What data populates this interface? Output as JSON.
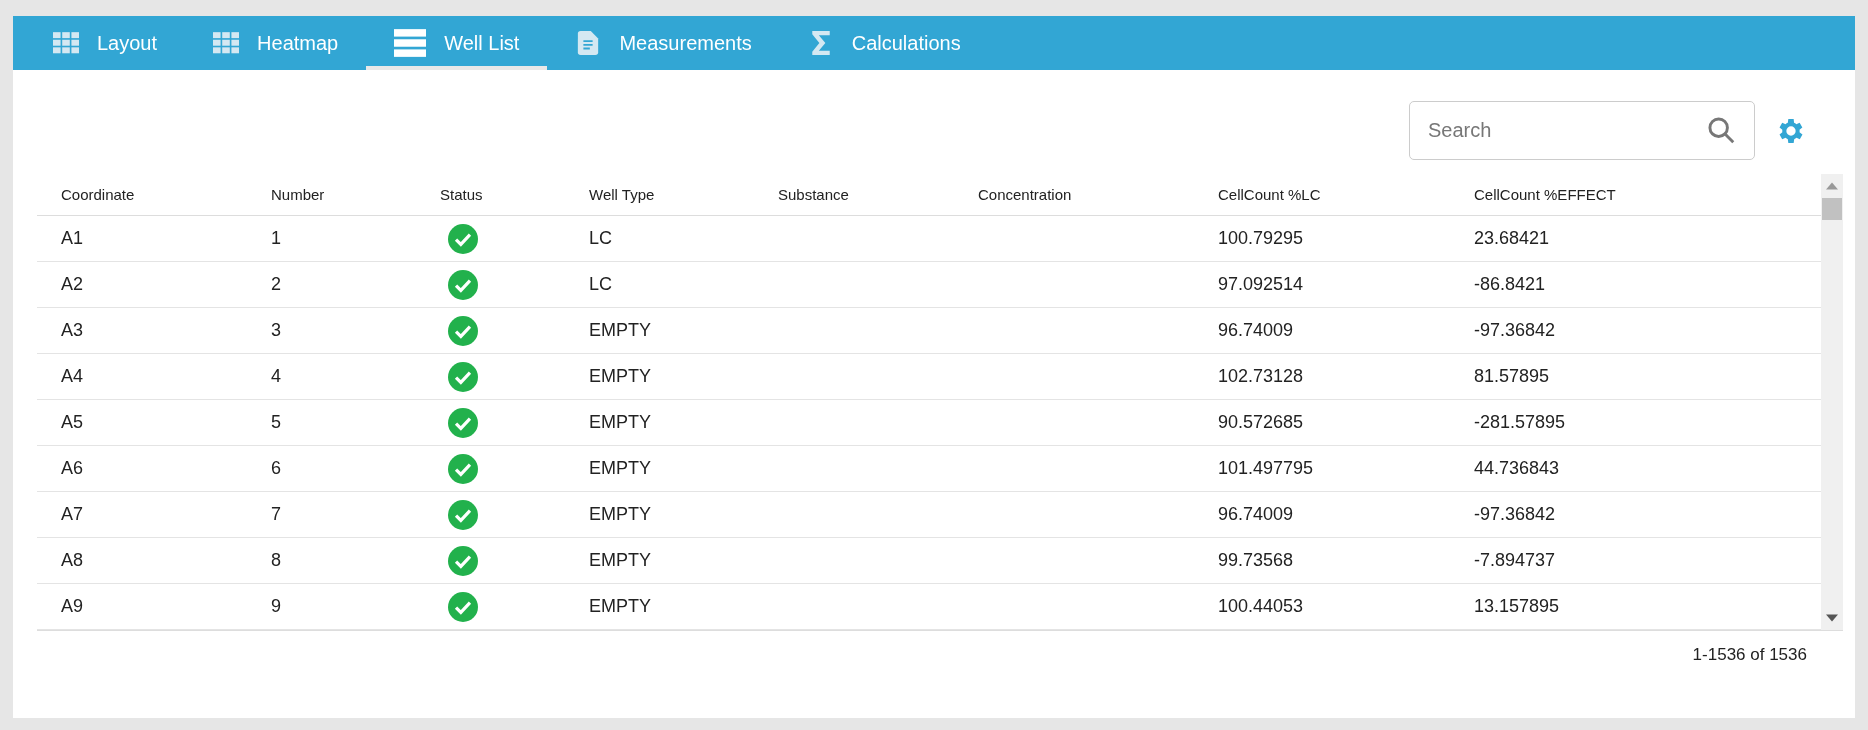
{
  "tabs": [
    {
      "label": "Layout",
      "selected": false
    },
    {
      "label": "Heatmap",
      "selected": false
    },
    {
      "label": "Well List",
      "selected": true
    },
    {
      "label": "Measurements",
      "selected": false
    },
    {
      "label": "Calculations",
      "selected": false
    }
  ],
  "search": {
    "placeholder": "Search"
  },
  "table": {
    "columns": [
      "Coordinate",
      "Number",
      "Status",
      "Well Type",
      "Substance",
      "Concentration",
      "CellCount %LC",
      "CellCount %EFFECT"
    ],
    "rows": [
      {
        "coordinate": "A1",
        "number": "1",
        "ok": true,
        "well_type": "LC",
        "cellcount_lc": "100.79295",
        "cellcount_effect": "23.68421"
      },
      {
        "coordinate": "A2",
        "number": "2",
        "ok": true,
        "well_type": "LC",
        "cellcount_lc": "97.092514",
        "cellcount_effect": "-86.8421"
      },
      {
        "coordinate": "A3",
        "number": "3",
        "ok": true,
        "well_type": "EMPTY",
        "cellcount_lc": "96.74009",
        "cellcount_effect": "-97.36842"
      },
      {
        "coordinate": "A4",
        "number": "4",
        "ok": true,
        "well_type": "EMPTY",
        "cellcount_lc": "102.73128",
        "cellcount_effect": "81.57895"
      },
      {
        "coordinate": "A5",
        "number": "5",
        "ok": true,
        "well_type": "EMPTY",
        "cellcount_lc": "90.572685",
        "cellcount_effect": "-281.57895"
      },
      {
        "coordinate": "A6",
        "number": "6",
        "ok": true,
        "well_type": "EMPTY",
        "cellcount_lc": "101.497795",
        "cellcount_effect": "44.736843"
      },
      {
        "coordinate": "A7",
        "number": "7",
        "ok": true,
        "well_type": "EMPTY",
        "cellcount_lc": "96.74009",
        "cellcount_effect": "-97.36842"
      },
      {
        "coordinate": "A8",
        "number": "8",
        "ok": true,
        "well_type": "EMPTY",
        "cellcount_lc": "99.73568",
        "cellcount_effect": "-7.894737"
      },
      {
        "coordinate": "A9",
        "number": "9",
        "ok": true,
        "well_type": "EMPTY",
        "cellcount_lc": "100.44053",
        "cellcount_effect": "13.157895"
      }
    ]
  },
  "pagination": "1-1536 of 1536"
}
